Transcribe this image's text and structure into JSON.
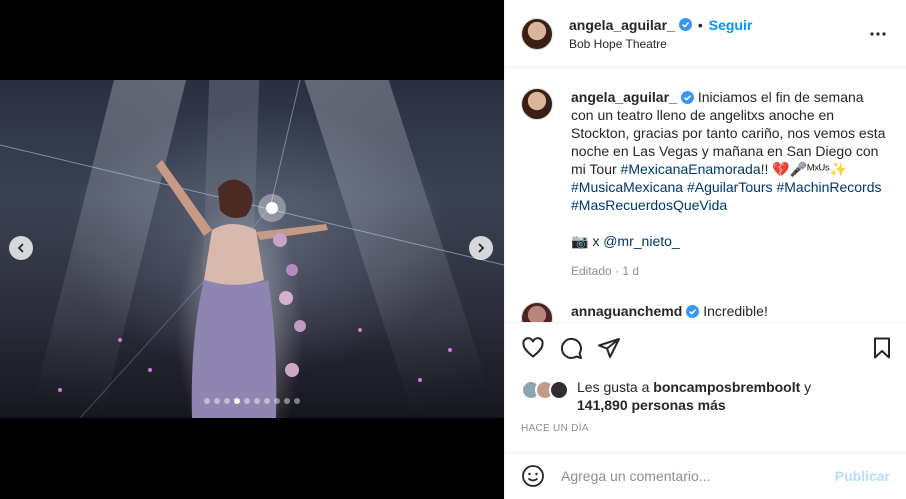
{
  "header": {
    "username": "angela_aguilar_",
    "follow_label": "Seguir",
    "separator": "•",
    "location": "Bob Hope Theatre"
  },
  "carousel": {
    "slide_count": 10,
    "active_index": 3
  },
  "caption": {
    "username": "angela_aguilar_",
    "text_1": "Iniciamos el fin de semana con un teatro lleno de angelitxs anoche en Stockton, gracias por tanto cariño, nos vemos esta noche en Las Vegas y mañana en San Diego con mi Tour ",
    "hashtag_1": "#MexicanaEnamorada",
    "text_2": "!! 💔🎤ᴹˣᵁˢ✨ ",
    "hashtag_2": "#MusicaMexicana",
    "hashtag_3": "#AguilarTours",
    "hashtag_4": "#MachinRecords",
    "hashtag_5": "#MasRecuerdosQueVida",
    "credit_prefix": "📷 x ",
    "credit_user": "@mr_nieto_",
    "meta": "Editado · 1 d"
  },
  "first_comment": {
    "username": "annaguanchemd",
    "text": "Incredible!"
  },
  "likes": {
    "prefix": "Les gusta a ",
    "user": "boncamposbremboolt",
    "suffix": " y",
    "count_text": "141,890 personas más"
  },
  "timestamp": "HACE UN DÍA",
  "comment_box": {
    "placeholder": "Agrega un comentario...",
    "post_label": "Publicar"
  },
  "colors": {
    "accent": "#0095f6",
    "hashtag": "#00376b",
    "verified": "#3897f0"
  }
}
